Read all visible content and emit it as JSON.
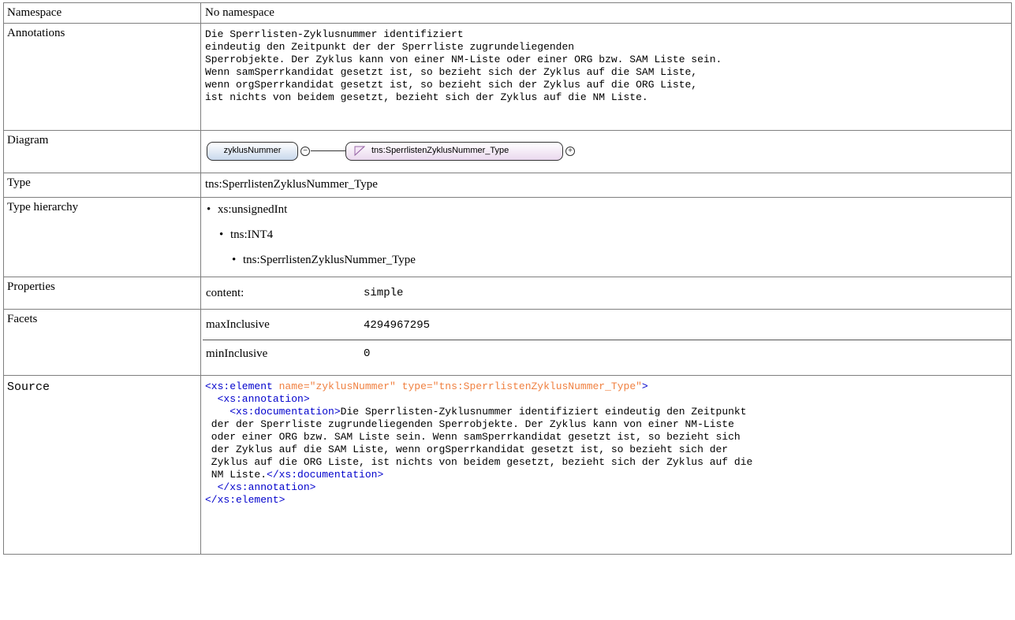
{
  "rows": {
    "namespace": {
      "label": "Namespace",
      "value": "No namespace"
    },
    "annotations": {
      "label": "Annotations",
      "lines": [
        "Die Sperrlisten-Zyklusnummer identifiziert",
        "eindeutig den Zeitpunkt der der Sperrliste zugrundeliegenden",
        "Sperrobjekte. Der Zyklus kann von einer NM-Liste oder einer ORG bzw. SAM Liste sein.",
        "Wenn samSperrkandidat gesetzt ist, so bezieht sich der Zyklus auf die SAM Liste,",
        "wenn orgSperrkandidat gesetzt ist, so bezieht sich der Zyklus auf die ORG Liste,",
        "ist nichts von beidem gesetzt, bezieht sich der Zyklus auf die NM Liste."
      ]
    },
    "diagram": {
      "label": "Diagram",
      "element_name": "zyklusNummer",
      "type_name": "tns:SperrlistenZyklusNummer_Type",
      "collapse_symbol": "−",
      "expand_symbol": "+"
    },
    "type": {
      "label": "Type",
      "value": "tns:SperrlistenZyklusNummer_Type"
    },
    "type_hierarchy": {
      "label": "Type hierarchy",
      "items": [
        "xs:unsignedInt",
        "tns:INT4",
        "tns:SperrlistenZyklusNummer_Type"
      ]
    },
    "properties": {
      "label": "Properties",
      "key": "content:",
      "value": "simple"
    },
    "facets": {
      "label": "Facets",
      "items": [
        {
          "key": "maxInclusive",
          "value": "4294967295"
        },
        {
          "key": "minInclusive",
          "value": "0"
        }
      ]
    },
    "source": {
      "label": "Source",
      "open_tag": "<xs:element",
      "attr1_name": " name=",
      "attr1_value": "\"zyklusNummer\"",
      "attr2_name": " type=",
      "attr2_value": "\"tns:SperrlistenZyklusNummer_Type\"",
      "open_tag_end": ">",
      "annotation_open": "  <xs:annotation>",
      "documentation_open": "    <xs:documentation>",
      "doc_lines": [
        "Die Sperrlisten-Zyklusnummer identifiziert eindeutig den Zeitpunkt",
        " der der Sperrliste zugrundeliegenden Sperrobjekte. Der Zyklus kann von einer NM-Liste",
        " oder einer ORG bzw. SAM Liste sein. Wenn samSperrkandidat gesetzt ist, so bezieht sich",
        " der Zyklus auf die SAM Liste, wenn orgSperrkandidat gesetzt ist, so bezieht sich der",
        " Zyklus auf die ORG Liste, ist nichts von beidem gesetzt, bezieht sich der Zyklus auf die",
        " NM Liste."
      ],
      "documentation_close": "</xs:documentation>",
      "annotation_close": "  </xs:annotation>",
      "element_close": "</xs:element>"
    }
  },
  "colors": {
    "tag": "#0000cc",
    "attribute": "#f08040",
    "attribute_value": "#9400d3",
    "element_node_fill": "#c8d8ec",
    "type_node_fill": "#ead8ee"
  },
  "icons": {
    "collapse": "minus-circle-icon",
    "expand": "plus-circle-icon",
    "simple_type": "simple-type-icon"
  }
}
